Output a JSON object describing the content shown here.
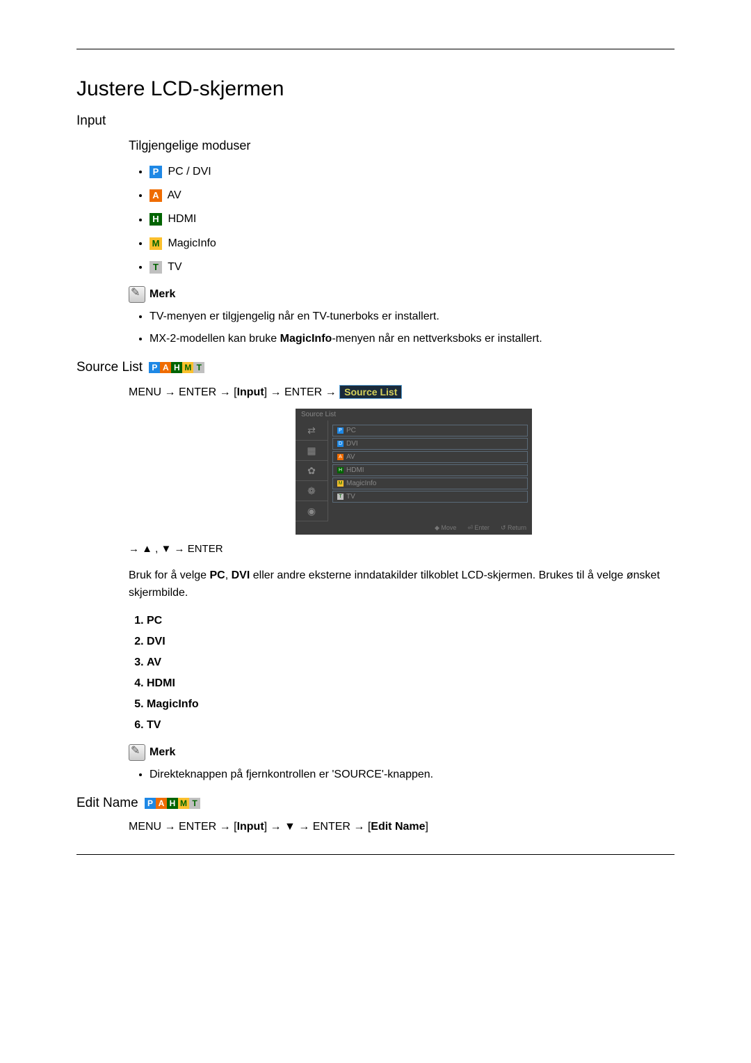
{
  "title": "Justere LCD-skjermen",
  "sections": {
    "input": {
      "heading": "Input",
      "modes_heading": "Tilgjengelige moduser",
      "modes": [
        {
          "badge": "P",
          "label": "PC / DVI"
        },
        {
          "badge": "A",
          "label": "AV"
        },
        {
          "badge": "H",
          "label": "HDMI"
        },
        {
          "badge": "M",
          "label": "MagicInfo"
        },
        {
          "badge": "T",
          "label": "TV"
        }
      ],
      "note_label": "Merk",
      "note_items": [
        "TV-menyen er tilgjengelig når en TV-tunerboks er installert.",
        "MX-2-modellen kan bruke MagicInfo-menyen når en nettverksboks er installert."
      ],
      "note_bold_word": "MagicInfo"
    },
    "source_list": {
      "heading": "Source List",
      "nav_prefix": "MENU → ENTER → [",
      "nav_input": "Input",
      "nav_mid": "] → ENTER → ",
      "nav_pill": "Source List",
      "osd": {
        "title": "Source List",
        "side_icons": [
          "⇄",
          "▦",
          "✿",
          "❁",
          "◉"
        ],
        "rows": [
          {
            "badge": "P",
            "label": "PC"
          },
          {
            "badge": "D",
            "label": "DVI"
          },
          {
            "badge": "A",
            "label": "AV"
          },
          {
            "badge": "H",
            "label": "HDMI"
          },
          {
            "badge": "M",
            "label": "MagicInfo"
          },
          {
            "badge": "T",
            "label": "TV"
          }
        ],
        "footer": [
          "◆ Move",
          "⏎ Enter",
          "↺ Return"
        ]
      },
      "arrow_line": "→ ▲ , ▼ → ENTER",
      "description_pre": "Bruk for å velge ",
      "description_bold1": "PC",
      "description_mid1": ", ",
      "description_bold2": "DVI",
      "description_post": " eller andre eksterne inndatakilder tilkoblet LCD-skjermen. Brukes til å velge ønsket skjermbilde.",
      "list": [
        {
          "label": "PC",
          "bold": true
        },
        {
          "label": "DVI",
          "bold": true
        },
        {
          "label": "AV",
          "bold": true
        },
        {
          "label": "HDMI",
          "bold": true
        },
        {
          "label": "MagicInfo",
          "bold": true
        },
        {
          "label": "TV",
          "bold": true
        }
      ],
      "note_label": "Merk",
      "note_items": [
        "Direkteknappen på fjernkontrollen er 'SOURCE'-knappen."
      ]
    },
    "edit_name": {
      "heading": "Edit Name",
      "nav_prefix": "MENU → ENTER → [",
      "nav_input": "Input",
      "nav_mid": "] → ▼ → ENTER → [",
      "nav_pill": "Edit Name",
      "nav_suffix": "]"
    }
  },
  "badge_letters": [
    "P",
    "A",
    "H",
    "M",
    "T"
  ]
}
